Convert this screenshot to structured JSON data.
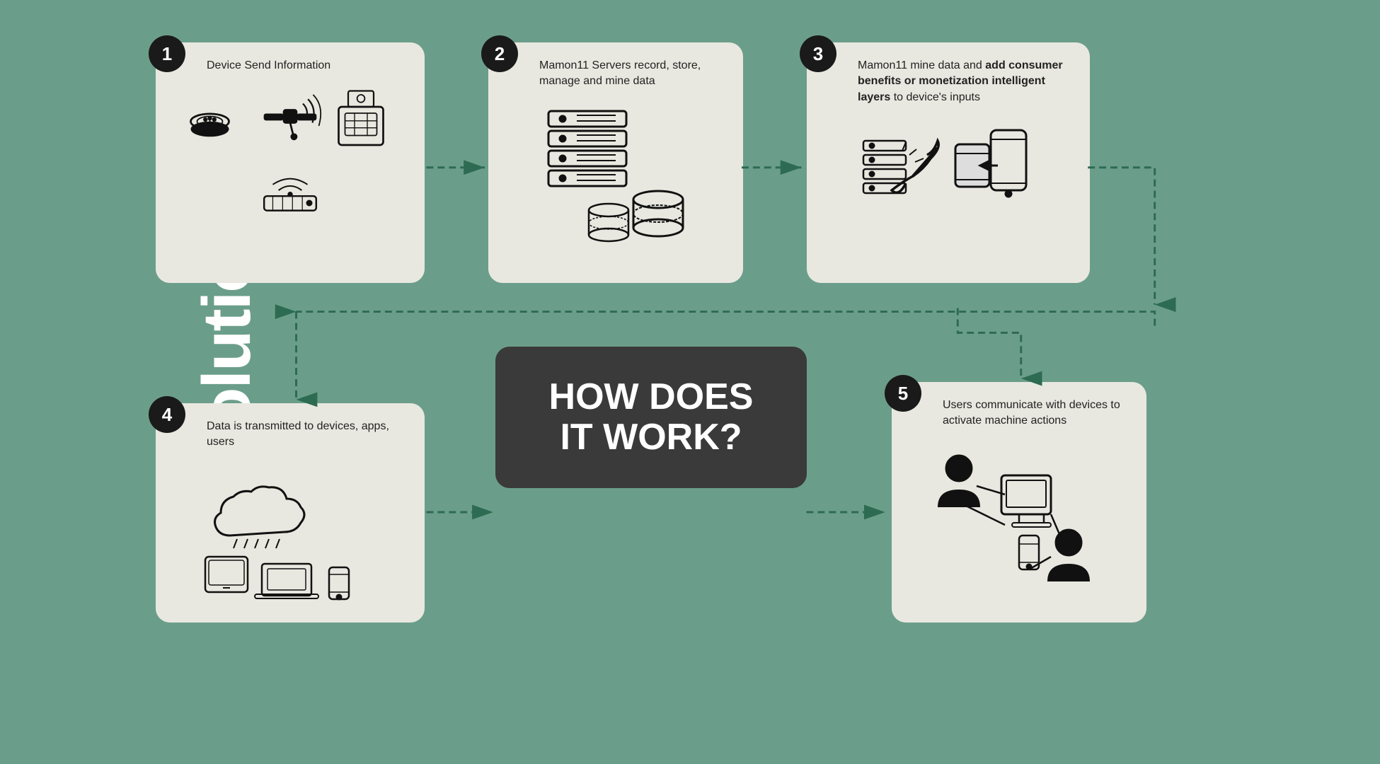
{
  "title": "IoT Solutions",
  "center": {
    "line1": "HOW DOES",
    "line2": "IT WORK?"
  },
  "steps": [
    {
      "number": "1",
      "title": "Device Send Information",
      "description": ""
    },
    {
      "number": "2",
      "title": "Mamon11 Servers record, store, manage and mine data",
      "description": ""
    },
    {
      "number": "3",
      "title_plain": "Mamon11 mine data and ",
      "title_bold": "add consumer benefits or monetization intelligent layers",
      "title_suffix": " to device's inputs",
      "description": ""
    },
    {
      "number": "4",
      "title": "Data is transmitted to devices, apps, users",
      "description": ""
    },
    {
      "number": "5",
      "title": "Users communicate with devices to activate machine actions",
      "description": ""
    }
  ],
  "colors": {
    "background": "#6b9e8a",
    "card": "#e8e8e0",
    "badge": "#1a1a1a",
    "center_box": "#3a3a3a",
    "arrow": "#2d6b52",
    "text": "#222222"
  }
}
